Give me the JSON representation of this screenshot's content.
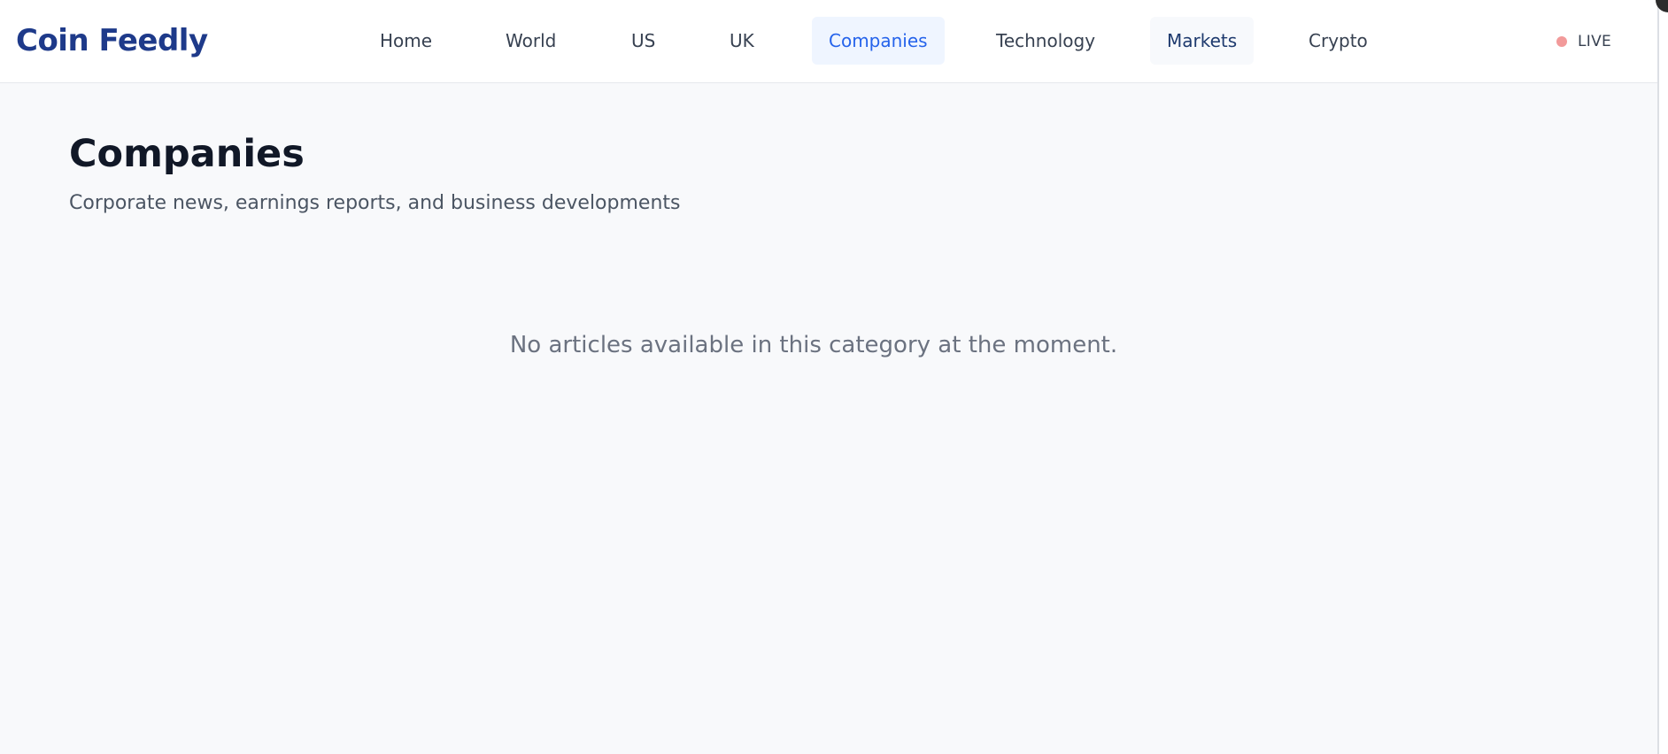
{
  "brand": {
    "name": "Coin Feedly",
    "color": "#1e3a8a"
  },
  "nav": {
    "items": [
      {
        "id": "home",
        "label": "Home"
      },
      {
        "id": "world",
        "label": "World"
      },
      {
        "id": "us",
        "label": "US"
      },
      {
        "id": "uk",
        "label": "UK"
      },
      {
        "id": "companies",
        "label": "Companies",
        "active": true
      },
      {
        "id": "technology",
        "label": "Technology"
      },
      {
        "id": "markets",
        "label": "Markets",
        "hovered": true
      },
      {
        "id": "crypto",
        "label": "Crypto"
      }
    ],
    "active_color": "#2563eb",
    "active_background": "#eff5ff"
  },
  "live": {
    "label": "LIVE",
    "dot_color": "#f29a9a",
    "icon": "live-dot-icon"
  },
  "page": {
    "title": "Companies",
    "subtitle": "Corporate news, earnings reports, and business developments",
    "empty_message": "No articles available in this category at the moment."
  }
}
